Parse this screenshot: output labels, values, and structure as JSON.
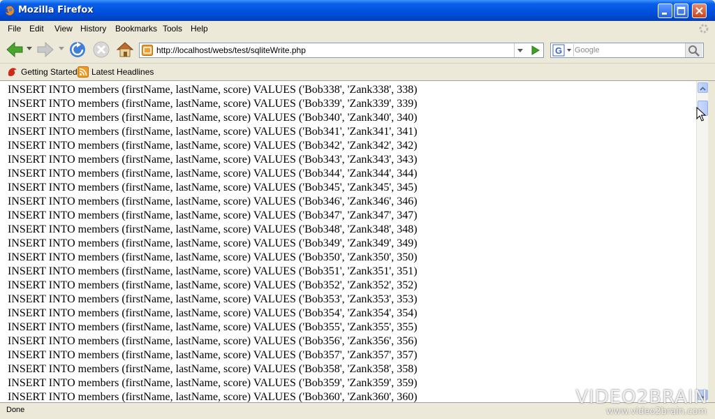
{
  "window": {
    "title": "Mozilla Firefox"
  },
  "menu": {
    "items": [
      "File",
      "Edit",
      "View",
      "History",
      "Bookmarks",
      "Tools",
      "Help"
    ]
  },
  "navigation": {
    "url": "http://localhost/webs/test/sqliteWrite.php",
    "search_placeholder": "Google",
    "buttons": [
      "back-icon",
      "forward-icon",
      "reload-icon",
      "stop-icon",
      "home-icon"
    ]
  },
  "bookmarks": {
    "items": [
      "Getting Started",
      "Latest Headlines"
    ]
  },
  "content": {
    "lines": [
      "INSERT INTO members (firstName, lastName, score) VALUES ('Bob338', 'Zank338', 338)",
      "INSERT INTO members (firstName, lastName, score) VALUES ('Bob339', 'Zank339', 339)",
      "INSERT INTO members (firstName, lastName, score) VALUES ('Bob340', 'Zank340', 340)",
      "INSERT INTO members (firstName, lastName, score) VALUES ('Bob341', 'Zank341', 341)",
      "INSERT INTO members (firstName, lastName, score) VALUES ('Bob342', 'Zank342', 342)",
      "INSERT INTO members (firstName, lastName, score) VALUES ('Bob343', 'Zank343', 343)",
      "INSERT INTO members (firstName, lastName, score) VALUES ('Bob344', 'Zank344', 344)",
      "INSERT INTO members (firstName, lastName, score) VALUES ('Bob345', 'Zank345', 345)",
      "INSERT INTO members (firstName, lastName, score) VALUES ('Bob346', 'Zank346', 346)",
      "INSERT INTO members (firstName, lastName, score) VALUES ('Bob347', 'Zank347', 347)",
      "INSERT INTO members (firstName, lastName, score) VALUES ('Bob348', 'Zank348', 348)",
      "INSERT INTO members (firstName, lastName, score) VALUES ('Bob349', 'Zank349', 349)",
      "INSERT INTO members (firstName, lastName, score) VALUES ('Bob350', 'Zank350', 350)",
      "INSERT INTO members (firstName, lastName, score) VALUES ('Bob351', 'Zank351', 351)",
      "INSERT INTO members (firstName, lastName, score) VALUES ('Bob352', 'Zank352', 352)",
      "INSERT INTO members (firstName, lastName, score) VALUES ('Bob353', 'Zank353', 353)",
      "INSERT INTO members (firstName, lastName, score) VALUES ('Bob354', 'Zank354', 354)",
      "INSERT INTO members (firstName, lastName, score) VALUES ('Bob355', 'Zank355', 355)",
      "INSERT INTO members (firstName, lastName, score) VALUES ('Bob356', 'Zank356', 356)",
      "INSERT INTO members (firstName, lastName, score) VALUES ('Bob357', 'Zank357', 357)",
      "INSERT INTO members (firstName, lastName, score) VALUES ('Bob358', 'Zank358', 358)",
      "INSERT INTO members (firstName, lastName, score) VALUES ('Bob359', 'Zank359', 359)",
      "INSERT INTO members (firstName, lastName, score) VALUES ('Bob360', 'Zank360', 360)"
    ]
  },
  "status": {
    "text": "Done"
  },
  "watermark": {
    "brand": "VIDEO2BRAIN",
    "url": "www.video2brain.com"
  },
  "colors": {
    "titlebar": "#0053e1",
    "chrome": "#ece9d8",
    "content_bg": "#ffffff"
  }
}
